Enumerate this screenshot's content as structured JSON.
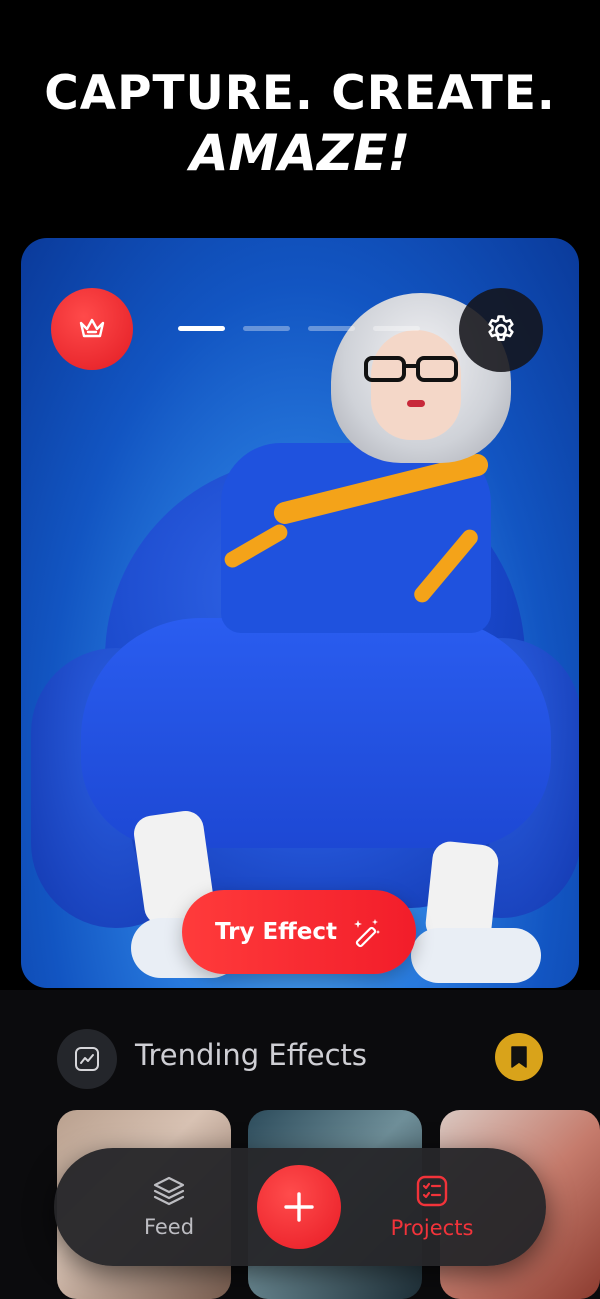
{
  "headline": {
    "line1": "CAPTURE. CREATE.",
    "line2": "AMAZE!"
  },
  "hero": {
    "premium_icon": "crown-icon",
    "settings_icon": "gear-icon",
    "slides": {
      "count": 4,
      "active_index": 0
    },
    "cta": {
      "label": "Try Effect",
      "icon": "magic-wand-icon"
    }
  },
  "trending": {
    "title": "Trending Effects",
    "leading_icon": "trend-chart-icon",
    "bookmark_icon": "bookmark-icon",
    "items": [
      {
        "id": "t1"
      },
      {
        "id": "t2"
      },
      {
        "id": "t3"
      }
    ]
  },
  "tabbar": {
    "feed": {
      "label": "Feed",
      "icon": "layers-icon"
    },
    "add": {
      "icon": "plus-icon"
    },
    "projects": {
      "label": "Projects",
      "icon": "checklist-icon"
    }
  },
  "colors": {
    "accent": "#f2333a",
    "gold": "#d9a31a",
    "background": "#000000"
  }
}
